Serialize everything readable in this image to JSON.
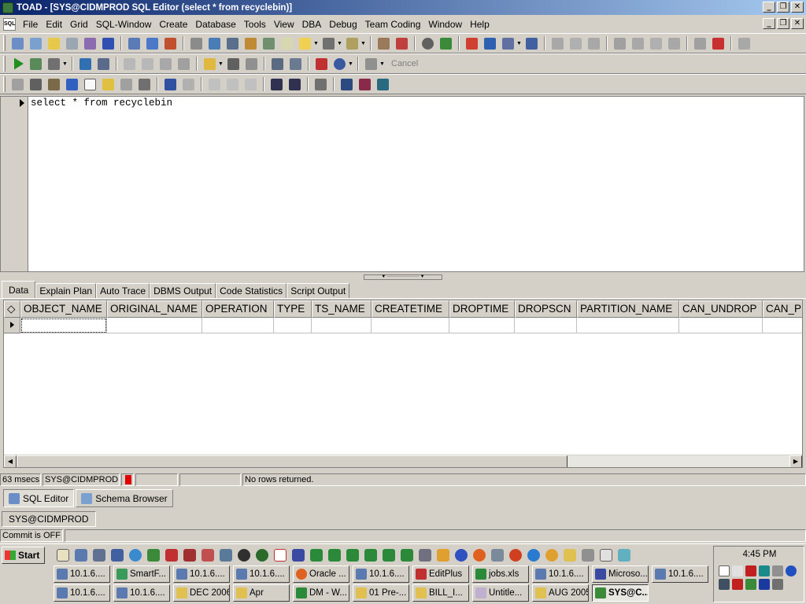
{
  "window": {
    "title": "TOAD - [SYS@CIDMPROD SQL Editor (select * from recyclebin)]"
  },
  "menu": [
    "File",
    "Edit",
    "Grid",
    "SQL-Window",
    "Create",
    "Database",
    "Tools",
    "View",
    "DBA",
    "Debug",
    "Team Coding",
    "Window",
    "Help"
  ],
  "toolbar": {
    "cancel_label": "Cancel"
  },
  "editor": {
    "sql": "select * from recyclebin"
  },
  "result_tabs": [
    "Data",
    "Explain Plan",
    "Auto Trace",
    "DBMS Output",
    "Code Statistics",
    "Script Output"
  ],
  "grid": {
    "columns": [
      "OBJECT_NAME",
      "ORIGINAL_NAME",
      "OPERATION",
      "TYPE",
      "TS_NAME",
      "CREATETIME",
      "DROPTIME",
      "DROPSCN",
      "PARTITION_NAME",
      "CAN_UNDROP",
      "CAN_PU"
    ]
  },
  "status": {
    "time": "63 msecs",
    "connection": "SYS@CIDMPROD",
    "message": "No rows returned."
  },
  "window_tabs": [
    "SQL Editor",
    "Schema Browser"
  ],
  "connection_tab": "SYS@CIDMPROD",
  "commit_status": "Commit is OFF",
  "taskbar": {
    "start_label": "Start",
    "row1": [
      {
        "label": "10.1.6....",
        "icon": "putty-icon"
      },
      {
        "label": "SmartF...",
        "icon": "smartftp-icon"
      },
      {
        "label": "10.1.6....",
        "icon": "putty-icon"
      },
      {
        "label": "10.1.6....",
        "icon": "putty-icon"
      },
      {
        "label": "Oracle ...",
        "icon": "firefox-icon"
      },
      {
        "label": "10.1.6....",
        "icon": "putty-icon"
      },
      {
        "label": "EditPlus",
        "icon": "editplus-icon"
      },
      {
        "label": "jobs.xls",
        "icon": "excel-icon"
      },
      {
        "label": "10.1.6....",
        "icon": "putty-icon"
      },
      {
        "label": "Microso...",
        "icon": "word-icon"
      },
      {
        "label": "10.1.6....",
        "icon": "putty-icon"
      }
    ],
    "row2": [
      {
        "label": "10.1.6....",
        "icon": "putty-icon"
      },
      {
        "label": "10.1.6....",
        "icon": "putty-icon"
      },
      {
        "label": "DEC 2006",
        "icon": "folder-icon"
      },
      {
        "label": "Apr",
        "icon": "folder-icon"
      },
      {
        "label": "DM - W...",
        "icon": "excel-icon"
      },
      {
        "label": "01 Pre-...",
        "icon": "folder-icon"
      },
      {
        "label": "BILL_I...",
        "icon": "folder-icon"
      },
      {
        "label": "Untitle...",
        "icon": "paint-icon"
      },
      {
        "label": "AUG 2005",
        "icon": "folder-icon"
      },
      {
        "label": "SYS@C...",
        "icon": "toad-icon"
      }
    ],
    "clock": "4:45 PM"
  },
  "colors": {
    "title_start": "#0a246a",
    "title_end": "#a6caf0",
    "face": "#d4d0c8"
  }
}
